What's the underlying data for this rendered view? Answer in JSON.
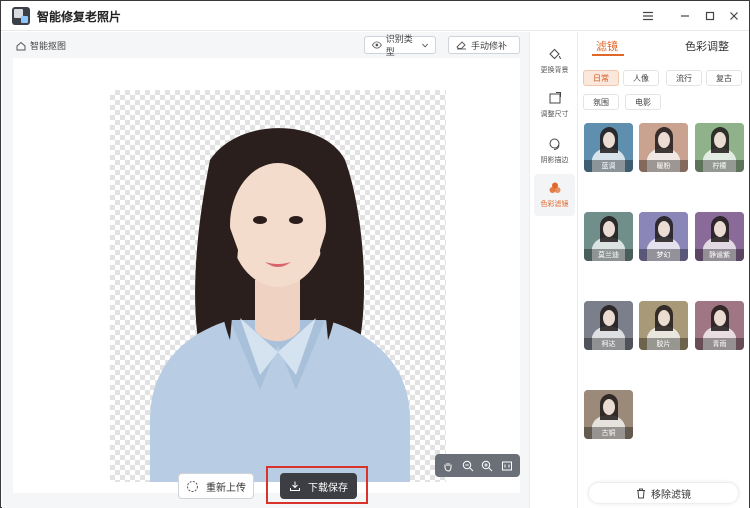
{
  "app": {
    "title": "智能修复老照片"
  },
  "toolbar": {
    "breadcrumb": "智能抠图",
    "detect_type": "识别类型",
    "manual_fix": "手动修补"
  },
  "actions": {
    "reupload": "重新上传",
    "download": "下载保存"
  },
  "sidebar": {
    "items": [
      {
        "label": "更换背景",
        "icon": "paint-bucket-icon"
      },
      {
        "label": "调整尺寸",
        "icon": "resize-icon"
      },
      {
        "label": "阴影描边",
        "icon": "shadow-icon"
      },
      {
        "label": "色彩滤镜",
        "icon": "color-filter-icon"
      }
    ],
    "active_index": 3
  },
  "panel": {
    "tabs": [
      {
        "label": "滤镜"
      },
      {
        "label": "色彩调整"
      }
    ],
    "active_tab": 0,
    "categories": [
      {
        "label": "日常"
      },
      {
        "label": "人像"
      },
      {
        "label": "流行"
      },
      {
        "label": "复古"
      },
      {
        "label": "氛围"
      },
      {
        "label": "电影"
      }
    ],
    "active_category": 0,
    "filters": [
      {
        "label": "蓝调",
        "tint": "#5e8fae"
      },
      {
        "label": "暖粉",
        "tint": "#c9a38f"
      },
      {
        "label": "柠檬",
        "tint": "#8fb28a"
      },
      {
        "label": "莫兰迪",
        "tint": "#708f8a"
      },
      {
        "label": "梦幻",
        "tint": "#8a86b8"
      },
      {
        "label": "静谧紫",
        "tint": "#8a6a98"
      },
      {
        "label": "柯达",
        "tint": "#7b7f8c"
      },
      {
        "label": "胶片",
        "tint": "#a89a78"
      },
      {
        "label": "青雨",
        "tint": "#a07584"
      },
      {
        "label": "古铜",
        "tint": "#9b8a7a"
      }
    ],
    "remove_filter": "移除滤镜"
  },
  "colors": {
    "accent": "#e0662a",
    "dark_button": "#3c3e44",
    "highlight_border": "#d9342b"
  }
}
